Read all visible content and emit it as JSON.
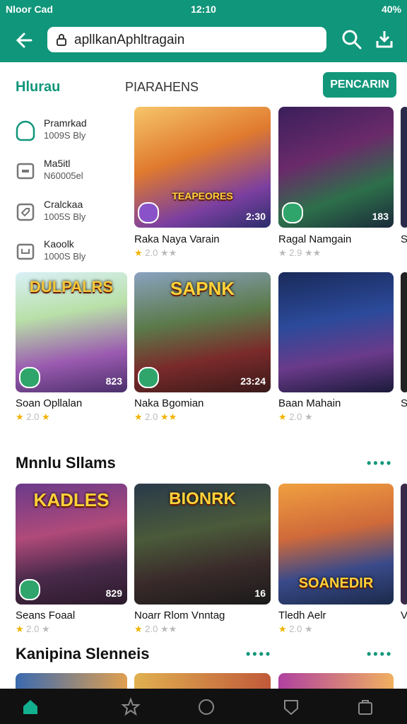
{
  "status": {
    "left": "Nloor Cad",
    "time": "12:10",
    "battery": "40%"
  },
  "search": {
    "query": "apllkanAphltragain"
  },
  "tabs": {
    "active": "Hlurau",
    "second": "PIARAHENS",
    "button": "PENCARIN"
  },
  "sidebar": {
    "items": [
      {
        "title": "Pramrkad",
        "sub": "1009S Bly",
        "icon": "shield-icon"
      },
      {
        "title": "Ma5itl",
        "sub": "N60005el",
        "icon": "tablet-icon"
      },
      {
        "title": "Cralckaa",
        "sub": "1005S Bly",
        "icon": "tag-icon"
      },
      {
        "title": "Kaoolk",
        "sub": "1000S Bly",
        "icon": "calendar-icon"
      }
    ]
  },
  "row1": [
    {
      "name": "Raka Naya Varain",
      "rating": "2.0",
      "count": "2:30",
      "title": "TEAPEORES"
    },
    {
      "name": "Ragal Namgain",
      "rating": "2.9",
      "count": "183",
      "title": ""
    },
    {
      "name": "S",
      "rating": "",
      "count": "",
      "title": ""
    }
  ],
  "row2": [
    {
      "name": "Soan Opllalan",
      "rating": "2.0",
      "count": "823",
      "title": "DULPALRS"
    },
    {
      "name": "Naka Bgomian",
      "rating": "2.0",
      "count": "23:24",
      "title": "SAPNK"
    },
    {
      "name": "Baan Mahain",
      "rating": "2.0",
      "count": "",
      "title": ""
    },
    {
      "name": "S",
      "rating": "",
      "count": "",
      "title": ""
    }
  ],
  "section1": {
    "title": "Mnnlu Sllams",
    "more": "••••"
  },
  "row3": [
    {
      "name": "Seans Foaal",
      "rating": "2.0",
      "count": "829",
      "title": "KADLES"
    },
    {
      "name": "Noarr Rlom Vnntag",
      "rating": "2.0",
      "count": "16",
      "title": "BIONRK"
    },
    {
      "name": "Tledh Aelr",
      "rating": "2.0",
      "count": "",
      "title": "SOANEDIR"
    },
    {
      "name": "V",
      "rating": "",
      "count": "",
      "title": ""
    }
  ],
  "section2": {
    "title": "Kanipina Slenneis",
    "more": "••••"
  }
}
